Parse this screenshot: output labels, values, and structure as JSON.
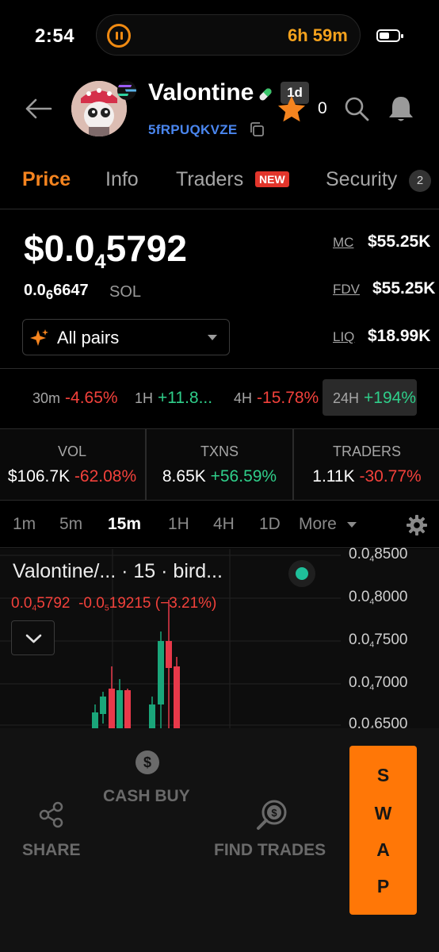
{
  "status_bar": {
    "time": "2:54",
    "timer": "6h 59m"
  },
  "header": {
    "token_name": "Valontine",
    "age_badge": "1d",
    "star_count": "0",
    "address": "5fRPUQKVZE"
  },
  "tabs": [
    {
      "label": "Price"
    },
    {
      "label": "Info"
    },
    {
      "label": "Traders",
      "badge": "NEW"
    },
    {
      "label": "Security",
      "count": "2"
    }
  ],
  "price": {
    "usd_prefix": "$0.0",
    "usd_sub": "4",
    "usd_digits": "5792",
    "sol_prefix": "0.0",
    "sol_sub": "6",
    "sol_digits": "6647",
    "sol_unit": "SOL",
    "pairs_label": "All pairs"
  },
  "stats": [
    {
      "label": "MC",
      "value": "$55.25K"
    },
    {
      "label": "FDV",
      "value": "$55.25K"
    },
    {
      "label": "LIQ",
      "value": "$18.99K"
    }
  ],
  "changes": [
    {
      "period": "30m",
      "value": "-4.65%"
    },
    {
      "period": "1H",
      "value": "+11.8..."
    },
    {
      "period": "4H",
      "value": "-15.78%"
    },
    {
      "period": "24H",
      "value": "+194%"
    }
  ],
  "metrics": [
    {
      "label": "VOL",
      "value": "$106.7K",
      "change": "-62.08%"
    },
    {
      "label": "TXNS",
      "value": "8.65K",
      "change": "+56.59%"
    },
    {
      "label": "TRADERS",
      "value": "1.11K",
      "change": "-30.77%"
    }
  ],
  "timeframes": [
    "1m",
    "5m",
    "15m",
    "1H",
    "4H",
    "1D",
    "More"
  ],
  "chart": {
    "title": "Valontine/...  · 15 · bird...",
    "ohlc_prefix": "0.0",
    "ohlc_sub": "4",
    "ohlc_digits": "5792",
    "ohlc_change_prefix": "-0.0",
    "ohlc_change_sub": "5",
    "ohlc_change_digits": "19215",
    "ohlc_pct": "(−3.21%)",
    "axis": [
      {
        "prefix": "0.0",
        "sub": "4",
        "digits": "8500"
      },
      {
        "prefix": "0.0",
        "sub": "4",
        "digits": "8000"
      },
      {
        "prefix": "0.0",
        "sub": "4",
        "digits": "7500"
      },
      {
        "prefix": "0.0",
        "sub": "4",
        "digits": "7000"
      },
      {
        "prefix": "0.0",
        "sub": "4",
        "digits": "6500"
      }
    ]
  },
  "bottom_bar": {
    "cash_buy": "CASH BUY",
    "share": "SHARE",
    "find_trades": "FIND TRADES",
    "swap": [
      "S",
      "W",
      "A",
      "P"
    ]
  },
  "colors": {
    "accent": "#f5841f",
    "positive": "#2fce8a",
    "negative": "#f2413b",
    "swap_button": "#ff7707",
    "address": "#4a86ef"
  }
}
